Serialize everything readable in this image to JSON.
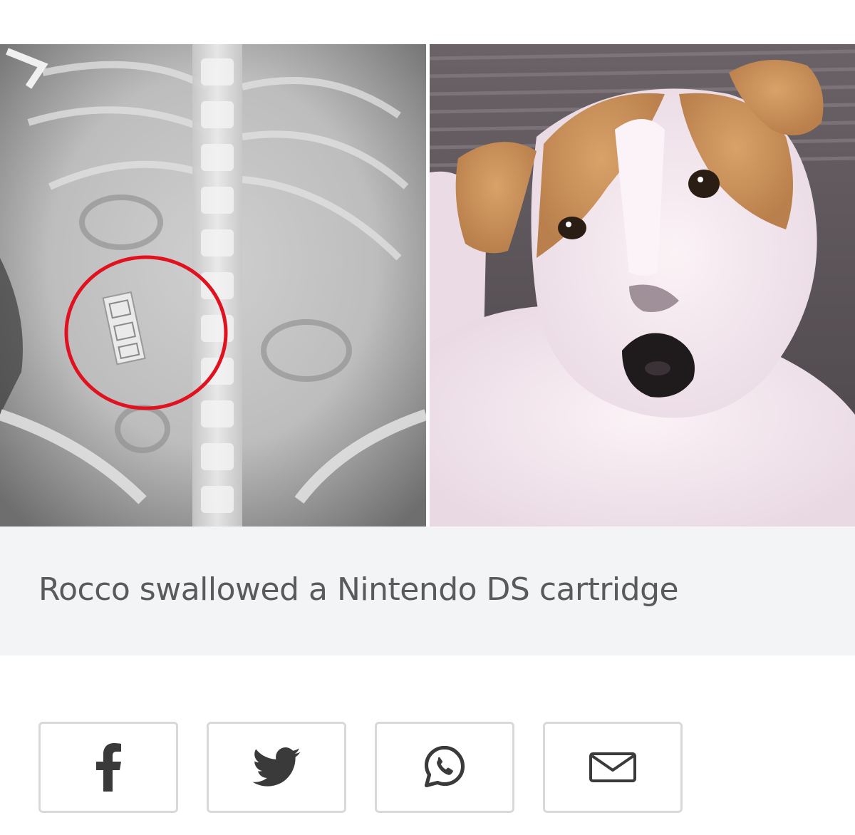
{
  "article_image": {
    "left_image": {
      "alt": "x-ray-of-dog-abdomen"
    },
    "right_image": {
      "alt": "jack-russell-dog"
    }
  },
  "caption": {
    "text": "Rocco swallowed a Nintendo DS cartridge"
  },
  "share": {
    "buttons": [
      {
        "icon": "facebook-icon"
      },
      {
        "icon": "twitter-icon"
      },
      {
        "icon": "whatsapp-icon"
      },
      {
        "icon": "email-icon"
      }
    ],
    "icon_color": "#3a3a3a",
    "border_color": "#d9d9db"
  },
  "colors": {
    "caption_background": "#f3f4f6",
    "caption_text": "#5a5a5a",
    "highlight_circle": "#e0121f"
  }
}
